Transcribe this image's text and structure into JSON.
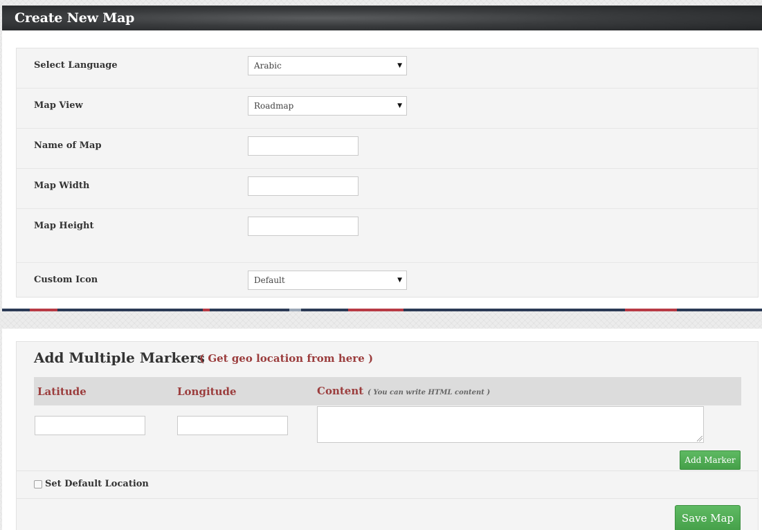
{
  "header": {
    "title": "Create New Map"
  },
  "form": {
    "language": {
      "label": "Select Language",
      "value": "Arabic"
    },
    "map_view": {
      "label": "Map View",
      "value": "Roadmap"
    },
    "name": {
      "label": "Name of Map",
      "value": ""
    },
    "width": {
      "label": "Map Width",
      "value": ""
    },
    "height": {
      "label": "Map Height",
      "value": ""
    },
    "custom_icon": {
      "label": "Custom Icon",
      "value": "Default"
    }
  },
  "markers": {
    "title": "Add Multiple Markers",
    "geo_link": "( Get geo location from here )",
    "columns": {
      "latitude": "Latitude",
      "longitude": "Longitude",
      "content": "Content",
      "content_note": "( You can write HTML content )"
    },
    "add_marker_label": "Add Marker",
    "default_location_label": "Set Default Location",
    "default_location_checked": false,
    "save_label": "Save Map"
  },
  "icons": {
    "dropdown": "dropdown-arrow-icon",
    "resize": "resize-grip-icon"
  },
  "colors": {
    "accent_red": "#9b3d3d",
    "button_green": "#4cae50",
    "titlebar_dark": "#2a2c2e"
  }
}
